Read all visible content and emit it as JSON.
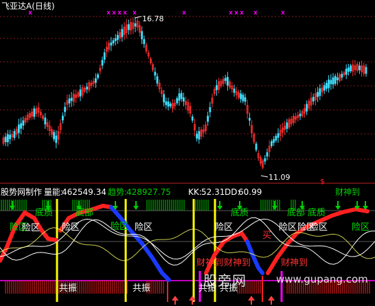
{
  "main_panel": {
    "title": "飞亚达A",
    "period": "(日线)",
    "high_label": "16.78",
    "low_label": "11.09",
    "marker_glyph": "$"
  },
  "indicator_panel": {
    "title": "股势网制作",
    "volume_label": "量能:",
    "volume_value": "462549.34",
    "trend_label": "趋势:",
    "trend_value": "428927.75",
    "kk_label": "KK:",
    "kk_value": "52.31",
    "dd_label": "DD:",
    "dd_value": "60.99",
    "caishendao_top": "财神到",
    "zone_labels": {
      "danger_zone": "险区",
      "bottom_zone": "底部",
      "bottom_zone_alt": "底质",
      "buy": "买",
      "caishendao": "财神到",
      "resonance": "共振"
    }
  },
  "watermark": {
    "cn": "股旁网",
    "url": "www.gupang.com"
  },
  "colors": {
    "background": "#000000",
    "up_candle": "#ff3030",
    "down_candle": "#40e0ff",
    "grid_dashed": "#8b1a1a",
    "separator": "#c02020",
    "yellow_line": "#ffff00",
    "green_zone": "#00d000",
    "red_band": "#ff2020",
    "blue_band": "#1a3aff",
    "magenta": "#ff00ff"
  }
}
